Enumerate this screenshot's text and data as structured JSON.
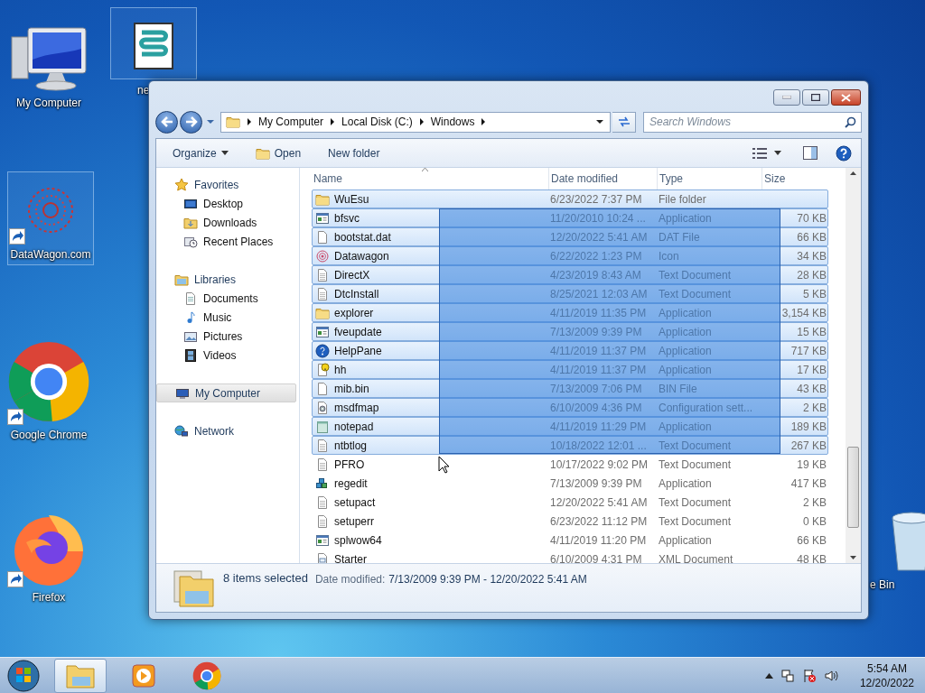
{
  "desktop_icons": [
    {
      "label": "My Computer",
      "kind": "computer",
      "shortcut": false,
      "selected": false
    },
    {
      "label": "ne",
      "kind": "script",
      "shortcut": false,
      "selected": true
    },
    {
      "label": "DataWagon.com",
      "kind": "mandala",
      "shortcut": true,
      "selected": true
    },
    {
      "label": "Google Chrome",
      "kind": "chrome",
      "shortcut": true,
      "selected": false
    },
    {
      "label": "Firefox",
      "kind": "firefox",
      "shortcut": true,
      "selected": false
    },
    {
      "label": "e Bin",
      "kind": "bin",
      "shortcut": false,
      "selected": false
    }
  ],
  "window": {
    "breadcrumb": [
      "My Computer",
      "Local Disk (C:)",
      "Windows"
    ],
    "search": {
      "placeholder": "Search Windows"
    },
    "toolbar": [
      {
        "label": "Organize",
        "kind": "menu"
      },
      {
        "label": "Open",
        "kind": "open"
      },
      {
        "label": "New folder",
        "kind": "plain"
      }
    ],
    "sidebar": [
      {
        "label": "Favorites",
        "selected": false,
        "children": [
          {
            "label": "Desktop",
            "selected": false
          },
          {
            "label": "Downloads",
            "selected": false
          },
          {
            "label": "Recent Places",
            "selected": false
          }
        ]
      },
      {
        "label": "Libraries",
        "selected": false,
        "children": [
          {
            "label": "Documents",
            "selected": false
          },
          {
            "label": "Music",
            "selected": false
          },
          {
            "label": "Pictures",
            "selected": false
          },
          {
            "label": "Videos",
            "selected": false
          }
        ]
      },
      {
        "label": "My Computer",
        "selected": true
      },
      {
        "label": "Network",
        "selected": false
      }
    ],
    "columns": [
      "Name",
      "Date modified",
      "Type",
      "Size"
    ],
    "rows": [
      {
        "name": "WuEsu",
        "date": "6/23/2022 7:37 PM",
        "type": "File folder",
        "size": "",
        "kind": "folder",
        "selected": true
      },
      {
        "name": "bfsvc",
        "date": "11/20/2010 10:24 ...",
        "type": "Application",
        "size": "70 KB",
        "kind": "program",
        "selected": true
      },
      {
        "name": "bootstat.dat",
        "date": "12/20/2022 5:41 AM",
        "type": "DAT File",
        "size": "66 KB",
        "kind": "page",
        "selected": true
      },
      {
        "name": "Datawagon",
        "date": "6/22/2022 1:23 PM",
        "type": "Icon",
        "size": "34 KB",
        "kind": "mandala",
        "selected": true
      },
      {
        "name": "DirectX",
        "date": "4/23/2019 8:43 AM",
        "type": "Text Document",
        "size": "28 KB",
        "kind": "text",
        "selected": true
      },
      {
        "name": "DtcInstall",
        "date": "8/25/2021 12:03 AM",
        "type": "Text Document",
        "size": "5 KB",
        "kind": "text",
        "selected": true
      },
      {
        "name": "explorer",
        "date": "4/11/2019 11:35 PM",
        "type": "Application",
        "size": "3,154 KB",
        "kind": "folder",
        "selected": true
      },
      {
        "name": "fveupdate",
        "date": "7/13/2009 9:39 PM",
        "type": "Application",
        "size": "15 KB",
        "kind": "program",
        "selected": true
      },
      {
        "name": "HelpPane",
        "date": "4/11/2019 11:37 PM",
        "type": "Application",
        "size": "717 KB",
        "kind": "help",
        "selected": true
      },
      {
        "name": "hh",
        "date": "4/11/2019 11:37 PM",
        "type": "Application",
        "size": "17 KB",
        "kind": "helppage",
        "selected": true
      },
      {
        "name": "mib.bin",
        "date": "7/13/2009 7:06 PM",
        "type": "BIN File",
        "size": "43 KB",
        "kind": "page",
        "selected": true
      },
      {
        "name": "msdfmap",
        "date": "6/10/2009 4:36 PM",
        "type": "Configuration sett...",
        "size": "2 KB",
        "kind": "config",
        "selected": true
      },
      {
        "name": "notepad",
        "date": "4/11/2019 11:29 PM",
        "type": "Application",
        "size": "189 KB",
        "kind": "notepad",
        "selected": true
      },
      {
        "name": "ntbtlog",
        "date": "10/18/2022 12:01 ...",
        "type": "Text Document",
        "size": "267 KB",
        "kind": "text",
        "selected": true
      },
      {
        "name": "PFRO",
        "date": "10/17/2022 9:02 PM",
        "type": "Text Document",
        "size": "19 KB",
        "kind": "text",
        "selected": false
      },
      {
        "name": "regedit",
        "date": "7/13/2009 9:39 PM",
        "type": "Application",
        "size": "417 KB",
        "kind": "cubes",
        "selected": false
      },
      {
        "name": "setupact",
        "date": "12/20/2022 5:41 AM",
        "type": "Text Document",
        "size": "2 KB",
        "kind": "text",
        "selected": false
      },
      {
        "name": "setuperr",
        "date": "6/23/2022 11:12 PM",
        "type": "Text Document",
        "size": "0 KB",
        "kind": "text",
        "selected": false
      },
      {
        "name": "splwow64",
        "date": "4/11/2019 11:20 PM",
        "type": "Application",
        "size": "66 KB",
        "kind": "program",
        "selected": false
      },
      {
        "name": "Starter",
        "date": "6/10/2009 4:31 PM",
        "type": "XML Document",
        "size": "48 KB",
        "kind": "xml",
        "selected": false
      }
    ],
    "details": {
      "count": "8 items selected",
      "label": "Date modified:",
      "value": "7/13/2009 9:39 PM - 12/20/2022 5:41 AM"
    }
  },
  "taskbar": {
    "items": [
      {
        "kind": "explorer",
        "selected": true
      },
      {
        "kind": "media",
        "selected": false
      },
      {
        "kind": "chrome",
        "selected": false
      }
    ],
    "time": "5:54 AM",
    "date": "12/20/2022"
  }
}
